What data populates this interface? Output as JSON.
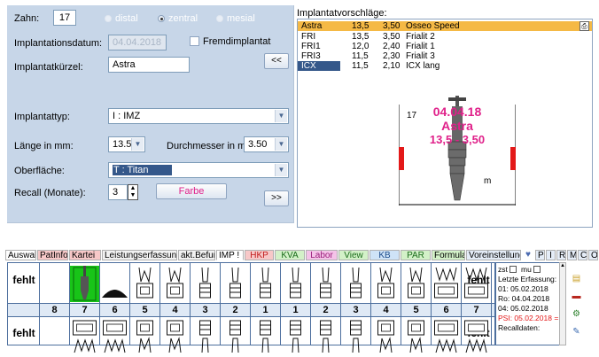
{
  "form": {
    "zahn_label": "Zahn:",
    "zahn_value": "17",
    "radio": {
      "distal": "distal",
      "zentral": "zentral",
      "mesial": "mesial"
    },
    "date_label": "Implantationsdatum:",
    "date_value": "04.04.2018",
    "fremd_label": "Fremdimplantat",
    "kuerzel_label": "Implantatkürzel:",
    "kuerzel_value": "Astra",
    "back_button": "<<",
    "typ_label": "Implantattyp:",
    "typ_value": "I    : IMZ",
    "laenge_label": "Länge in mm:",
    "laenge_value": "13.5",
    "durchmesser_label": "Durchmesser in mm:",
    "durchmesser_value": "3.50",
    "oberflaeche_label": "Oberfläche:",
    "oberflaeche_value": "T    : Titan",
    "recall_label": "Recall (Monate):",
    "recall_value": "3",
    "farbe_button": "Farbe",
    "forward_button": ">>"
  },
  "suggestions": {
    "title": "Implantatvorschläge:",
    "rows": [
      {
        "code": "Astra",
        "laenge": "13,5",
        "durchmesser": "3,50",
        "name": "Osseo Speed"
      },
      {
        "code": "FRI",
        "laenge": "13,5",
        "durchmesser": "3,50",
        "name": "Frialit 2"
      },
      {
        "code": "FRI1",
        "laenge": "12,0",
        "durchmesser": "2,40",
        "name": "Frialit 1"
      },
      {
        "code": "FRI3",
        "laenge": "11,5",
        "durchmesser": "2,30",
        "name": "Frialit 3"
      },
      {
        "code": "ICX",
        "laenge": "11,5",
        "durchmesser": "2,10",
        "name": "ICX lang"
      }
    ],
    "preview": {
      "tooth": "17",
      "date": "04.04.18",
      "name": "Astra",
      "size": "13,5 - 3,50",
      "unit": "m"
    }
  },
  "tabs": [
    {
      "label": "Auswahl",
      "bg": "#ffffff"
    },
    {
      "label": "PatInfo",
      "bg": "#f7c8c8"
    },
    {
      "label": "Kartei",
      "bg": "#f7c8c8"
    },
    {
      "label": "Leistungserfassung I",
      "bg": "#f2f2f2"
    },
    {
      "label": "akt.Befund",
      "bg": "#f2f2f2"
    },
    {
      "label": "IMP !",
      "bg": "#ffffff"
    },
    {
      "label": "HKP",
      "bg": "#f7c8c8"
    },
    {
      "label": "KVA",
      "bg": "#d3f1c8"
    },
    {
      "label": "Labor",
      "bg": "#f4c3e8"
    },
    {
      "label": "View",
      "bg": "#d3f1c8"
    },
    {
      "label": "KB",
      "bg": "#cfe3f7"
    },
    {
      "label": "PAR",
      "bg": "#d3f1c8"
    },
    {
      "label": "Formular",
      "bg": "#d3f1c8"
    },
    {
      "label": "Voreinstellungen",
      "bg": "#e4ecf7"
    },
    {
      "label": "P",
      "bg": "#e4ecf7"
    },
    {
      "label": "I",
      "bg": "#e4ecf7"
    },
    {
      "label": "R",
      "bg": "#e4ecf7"
    },
    {
      "label": "M",
      "bg": "#e4ecf7"
    },
    {
      "label": "C",
      "bg": "#e4ecf7"
    },
    {
      "label": "O",
      "bg": "#e4ecf7"
    }
  ],
  "chart": {
    "fehlt": "fehlt",
    "numbers": [
      "8",
      "7",
      "6",
      "5",
      "4",
      "3",
      "2",
      "1",
      "1",
      "2",
      "3",
      "4",
      "5",
      "6",
      "7",
      "8"
    ]
  },
  "info": {
    "zst": "zst",
    "mu": "mu",
    "line1": "Letzte Erfassung:",
    "line2": "01: 05.02.2018",
    "line3": "Ro: 04.04.2018",
    "line4": "04: 05.02.2018",
    "line5": "PSI: 05.02.2018 =",
    "line6": "Recalldaten:"
  },
  "colors": {
    "panel": "#c7d6e8",
    "highlight": "#f5b945",
    "selection": "#35588a",
    "magenta": "#e0218a",
    "red": "#e31919",
    "implant_green": "#18c418"
  }
}
